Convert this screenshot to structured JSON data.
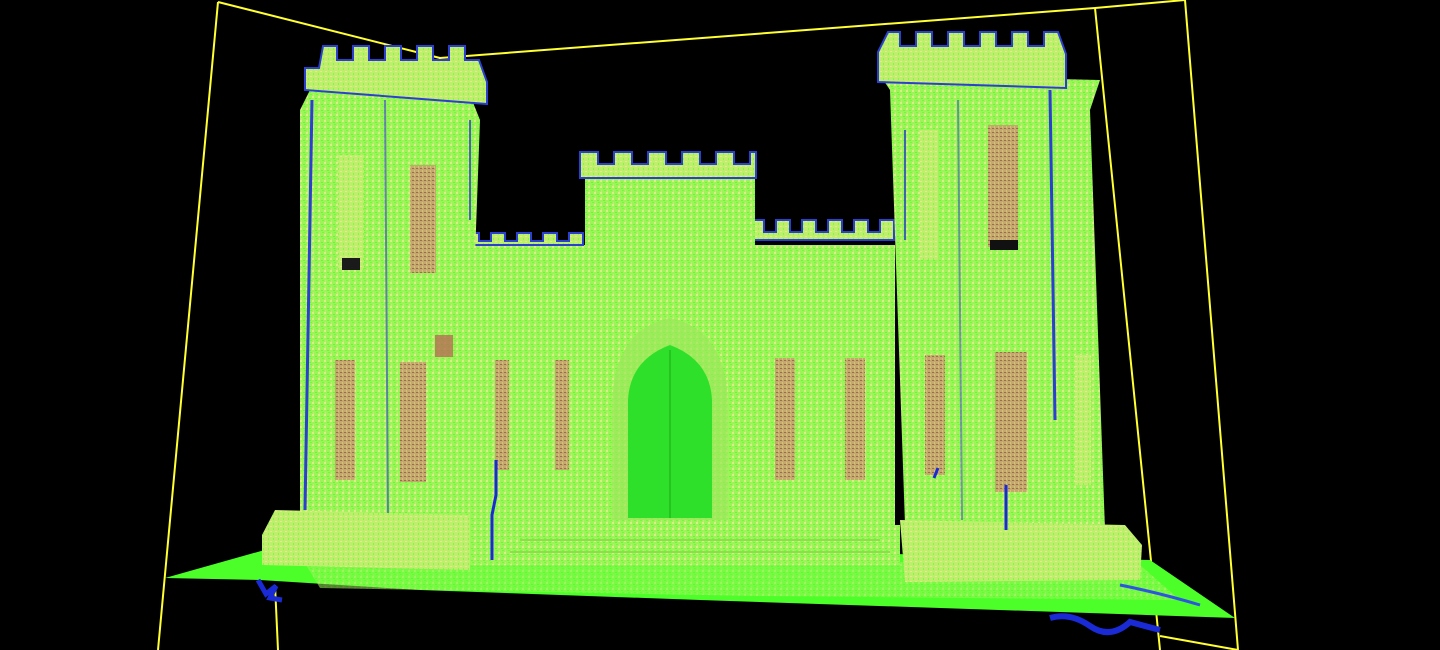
{
  "viewer": {
    "background_color": "#000000",
    "bounding_box_color": "#ffff33"
  },
  "scan": {
    "subject": "castle-facade-point-cloud",
    "colors": {
      "high": "#4cff29",
      "mid": "#c8ee7a",
      "pale": "#e6e88a",
      "low": "#1a2bd6",
      "window_fill": "#b89a62",
      "window_dark": "#8a5a4a",
      "door": "#2fe02a"
    }
  }
}
